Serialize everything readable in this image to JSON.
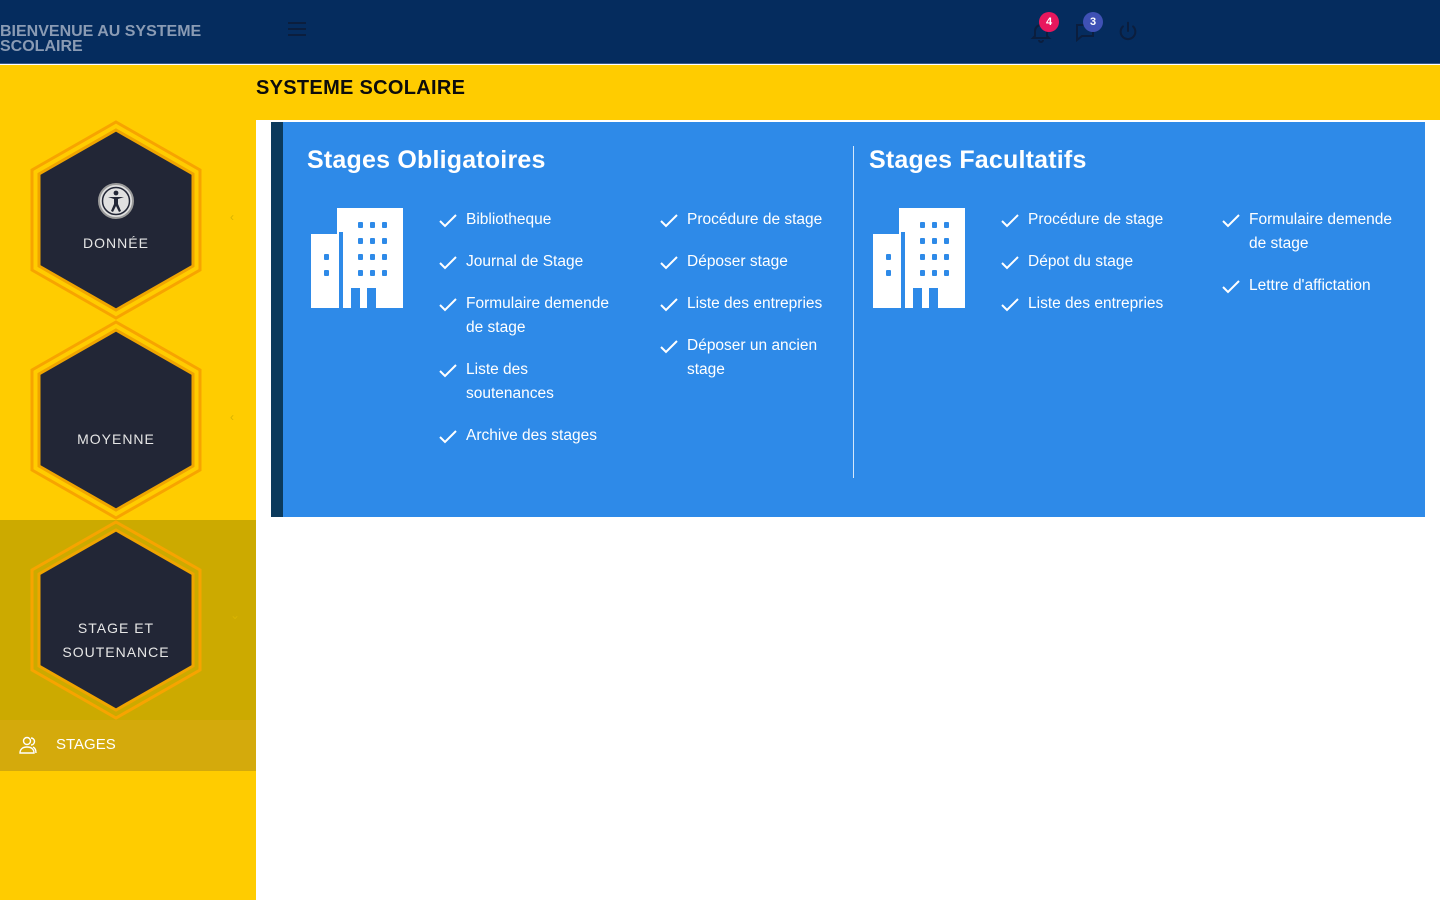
{
  "topbar": {
    "brand": "BIENVENUE AU SYSTEME SCOLAIRE",
    "notifications_count": "4",
    "messages_count": "3"
  },
  "sidebar": {
    "items": [
      {
        "label": "DONNÉE",
        "icon": "accessibility-icon",
        "chevron": "‹"
      },
      {
        "label": "MOYENNE",
        "chevron": "‹"
      },
      {
        "label_line1": "STAGE ET",
        "label_line2": "SOUTENANCE",
        "chevron": "⌄",
        "active": true
      }
    ],
    "sub_item": {
      "label": "STAGES",
      "icon": "users-icon"
    }
  },
  "page": {
    "title": "SYSTEME SCOLAIRE"
  },
  "obligatoires": {
    "title": "Stages Obligatoires",
    "col1": [
      "Bibliotheque",
      "Journal de Stage",
      "Formulaire demende de stage",
      "Liste des soutenances",
      "Archive des stages"
    ],
    "col2": [
      "Procédure de stage",
      "Déposer stage",
      "Liste des entrepries",
      "Déposer un ancien stage"
    ]
  },
  "facultatifs": {
    "title": "Stages Facultatifs",
    "col1": [
      "Procédure de stage",
      "Dépot du stage",
      "Liste des entrepries"
    ],
    "col2": [
      "Formulaire demende de stage",
      "Lettre d'affictation"
    ]
  },
  "colors": {
    "topbar": "#052c5e",
    "sidebar": "#ffcc00",
    "card": "#2e8ae8",
    "hexagon": "#222636",
    "badge_red": "#e8175d",
    "badge_blue": "#3f51b5"
  }
}
